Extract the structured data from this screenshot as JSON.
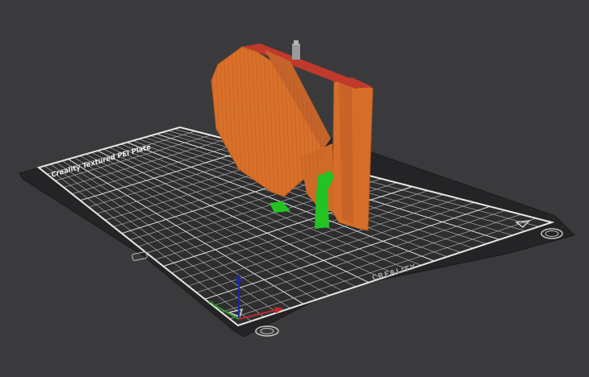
{
  "viewport": {
    "background": "#3a3a3c"
  },
  "bed": {
    "plate_label": "Creality Textured PEI Plate",
    "brand_label": "CREALITY",
    "colors": {
      "plate": "#2b2b2d",
      "plate_edge": "#1f1f21",
      "grid": "#d8d8d8",
      "border_line": "#e6e6e6"
    }
  },
  "model": {
    "colors": {
      "body": "#d9702a",
      "body_dark": "#b95a1e",
      "top_overhang": "#c0392b",
      "support": "#22c322",
      "pin": "#9a9a9a"
    }
  },
  "axes": {
    "x_color": "#c0282d",
    "y_color": "#2aa02a",
    "z_color": "#1a2aa0"
  },
  "icons": {
    "bed_corner_icons": [
      "warning-triangle-icon",
      "fan-grille-icon",
      "warning-triangle-icon",
      "fan-grille-icon"
    ]
  }
}
